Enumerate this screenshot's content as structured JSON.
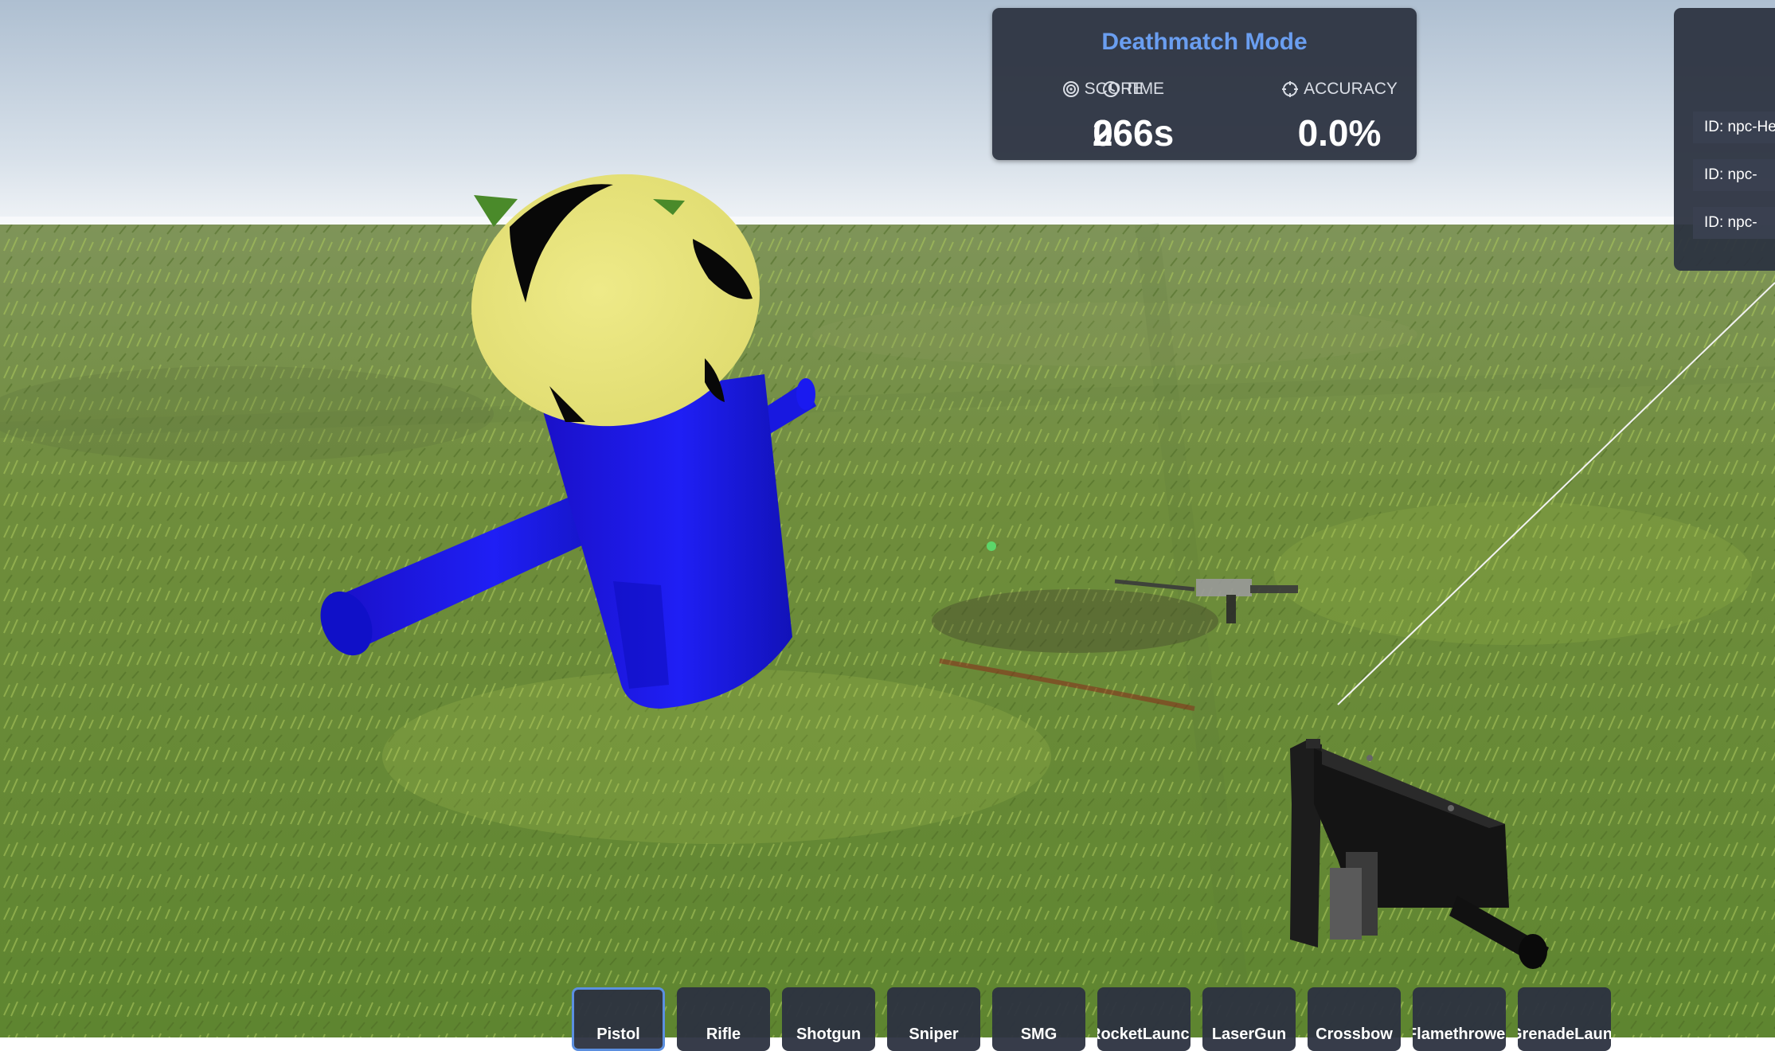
{
  "hud": {
    "mode_title": "Deathmatch Mode",
    "stats": [
      {
        "label": "SCORE",
        "value": "0",
        "icon": "target-icon"
      },
      {
        "label": "TIME",
        "value": "266s",
        "icon": "clock-icon"
      },
      {
        "label": "ACCURACY",
        "value": "0.0%",
        "icon": "crosshair-icon"
      }
    ]
  },
  "entity_list": {
    "items": [
      {
        "label": "ID: npc-Hea"
      },
      {
        "label": "ID: npc-"
      },
      {
        "label": "ID: npc-"
      }
    ]
  },
  "weapons": {
    "active_index": 0,
    "items": [
      {
        "label": "Pistol"
      },
      {
        "label": "Rifle"
      },
      {
        "label": "Shotgun"
      },
      {
        "label": "Sniper"
      },
      {
        "label": "SMG"
      },
      {
        "label": "RocketLauncher"
      },
      {
        "label": "LaserGun"
      },
      {
        "label": "Crossbow"
      },
      {
        "label": "Flamethrower"
      },
      {
        "label": "GrenadeLauncher"
      }
    ]
  },
  "colors": {
    "hud_panel": "#2c3240",
    "mode_title": "#6a9ef0",
    "active_weapon_border": "#5b8fe0",
    "npc_body": "#1a1ae6",
    "npc_head": "#e6e277",
    "grass": "#6d8a3a",
    "sky": "#c9d6e4"
  }
}
